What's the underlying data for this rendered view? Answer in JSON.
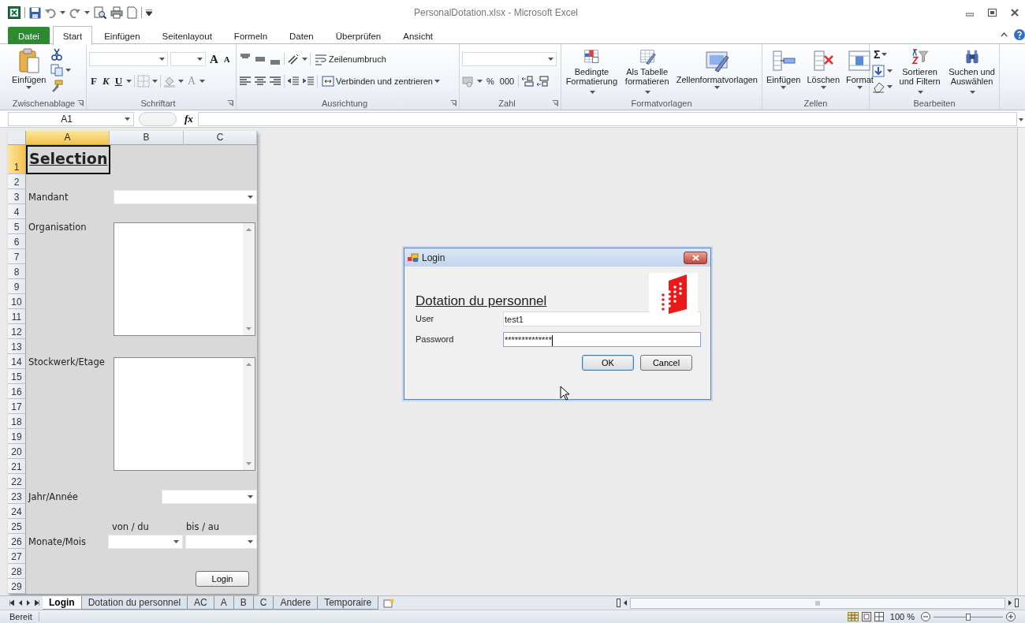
{
  "window": {
    "title": "PersonalDotation.xlsx - Microsoft Excel"
  },
  "ribbon_tabs": [
    {
      "label": "Datei",
      "kind": "file",
      "selected": false
    },
    {
      "label": "Start",
      "kind": "tab",
      "selected": true
    },
    {
      "label": "Einfügen",
      "kind": "tab",
      "selected": false
    },
    {
      "label": "Seitenlayout",
      "kind": "tab",
      "selected": false
    },
    {
      "label": "Formeln",
      "kind": "tab",
      "selected": false
    },
    {
      "label": "Daten",
      "kind": "tab",
      "selected": false
    },
    {
      "label": "Überprüfen",
      "kind": "tab",
      "selected": false
    },
    {
      "label": "Ansicht",
      "kind": "tab",
      "selected": false
    }
  ],
  "ribbon": {
    "clipboard": {
      "label": "Zwischenablage",
      "paste": "Einfügen"
    },
    "font": {
      "label": "Schriftart",
      "grow": "A",
      "shrink": "A",
      "bold": "F",
      "italic": "K",
      "underline": "U",
      "font_color": "A"
    },
    "alignment": {
      "label": "Ausrichtung",
      "wrap_text": "Zeilenumbruch",
      "merge": "Verbinden und zentrieren"
    },
    "number": {
      "label": "Zahl",
      "percent": "%",
      "thousands": "000"
    },
    "styles": {
      "label": "Formatvorlagen",
      "buttons": [
        "Bedingte\nFormatierung",
        "Als Tabelle\nformatieren",
        "Zellenformatvorlagen"
      ]
    },
    "cells": {
      "label": "Zellen",
      "buttons": [
        "Einfügen",
        "Löschen",
        "Format"
      ]
    },
    "editing": {
      "label": "Bearbeiten",
      "sum": "Σ",
      "buttons": [
        "Sortieren\nund Filtern",
        "Suchen und\nAuswählen"
      ]
    }
  },
  "formula_bar": {
    "name_box": "A1",
    "fx": "fx"
  },
  "sheet": {
    "columns": [
      {
        "label": "A",
        "selected": true
      },
      {
        "label": "B",
        "selected": false
      },
      {
        "label": "C",
        "selected": false
      }
    ],
    "rows": [
      {
        "label": "1",
        "selected": true
      },
      {
        "label": "2",
        "selected": false
      },
      {
        "label": "3",
        "selected": false
      },
      {
        "label": "4",
        "selected": false
      },
      {
        "label": "5",
        "selected": false
      },
      {
        "label": "6",
        "selected": false
      },
      {
        "label": "7",
        "selected": false
      },
      {
        "label": "8",
        "selected": false
      },
      {
        "label": "9",
        "selected": false
      },
      {
        "label": "10",
        "selected": false
      },
      {
        "label": "11",
        "selected": false
      },
      {
        "label": "12",
        "selected": false
      },
      {
        "label": "13",
        "selected": false
      },
      {
        "label": "14",
        "selected": false
      },
      {
        "label": "15",
        "selected": false
      },
      {
        "label": "16",
        "selected": false
      },
      {
        "label": "17",
        "selected": false
      },
      {
        "label": "18",
        "selected": false
      },
      {
        "label": "19",
        "selected": false
      },
      {
        "label": "20",
        "selected": false
      },
      {
        "label": "21",
        "selected": false
      },
      {
        "label": "22",
        "selected": false
      },
      {
        "label": "23",
        "selected": false
      },
      {
        "label": "24",
        "selected": false
      },
      {
        "label": "25",
        "selected": false
      },
      {
        "label": "26",
        "selected": false
      },
      {
        "label": "27",
        "selected": false
      },
      {
        "label": "28",
        "selected": false
      },
      {
        "label": "29",
        "selected": false
      }
    ],
    "form": {
      "title": "Selection",
      "mandant_label": "Mandant",
      "organisation_label": "Organisation",
      "floor_label": "Stockwerk/Etage",
      "year_label": "Jahr/Année",
      "from_label": "von / du",
      "to_label": "bis / au",
      "months_label": "Monate/Mois",
      "login_button": "Login"
    }
  },
  "dialog": {
    "title": "Login",
    "heading": "Dotation du personnel",
    "user_label": "User",
    "user_value": "test1",
    "password_label": "Password",
    "password_value": "**************",
    "ok_button": "OK",
    "cancel_button": "Cancel"
  },
  "sheet_tabs": [
    {
      "label": "Login",
      "selected": true
    },
    {
      "label": "Dotation du personnel",
      "selected": false
    },
    {
      "label": "AC",
      "selected": false
    },
    {
      "label": "A",
      "selected": false
    },
    {
      "label": "B",
      "selected": false
    },
    {
      "label": "C",
      "selected": false
    },
    {
      "label": "Andere",
      "selected": false
    },
    {
      "label": "Temporaire",
      "selected": false
    }
  ],
  "status_bar": {
    "text": "Bereit",
    "zoom": "100 %",
    "zoom_slider": {
      "level": 0.5
    }
  }
}
